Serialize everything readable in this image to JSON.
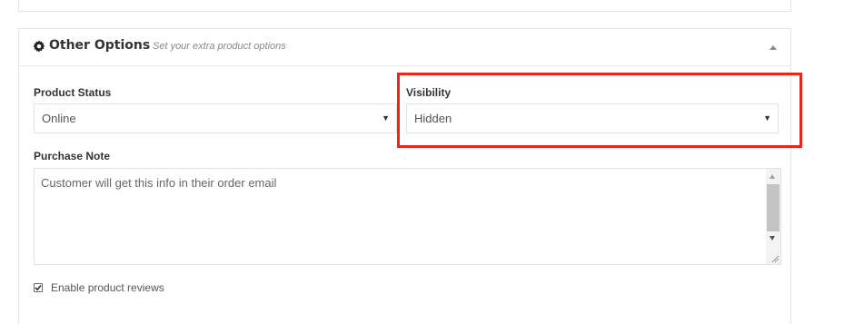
{
  "colors": {
    "highlight": "#e8261f",
    "border": "#e3e3e3",
    "label": "#333333",
    "text": "#555555"
  },
  "other_options": {
    "icon": "gear-icon",
    "title": "Other Options",
    "subtitle": "Set your extra product options",
    "collapse_icon": "caret-up-icon"
  },
  "product_status": {
    "label": "Product Status",
    "value": "Online"
  },
  "visibility": {
    "label": "Visibility",
    "value": "Hidden"
  },
  "purchase_note": {
    "label": "Purchase Note",
    "value": "Customer will get this info in their order email"
  },
  "reviews": {
    "checked": true,
    "label": "Enable product reviews"
  }
}
